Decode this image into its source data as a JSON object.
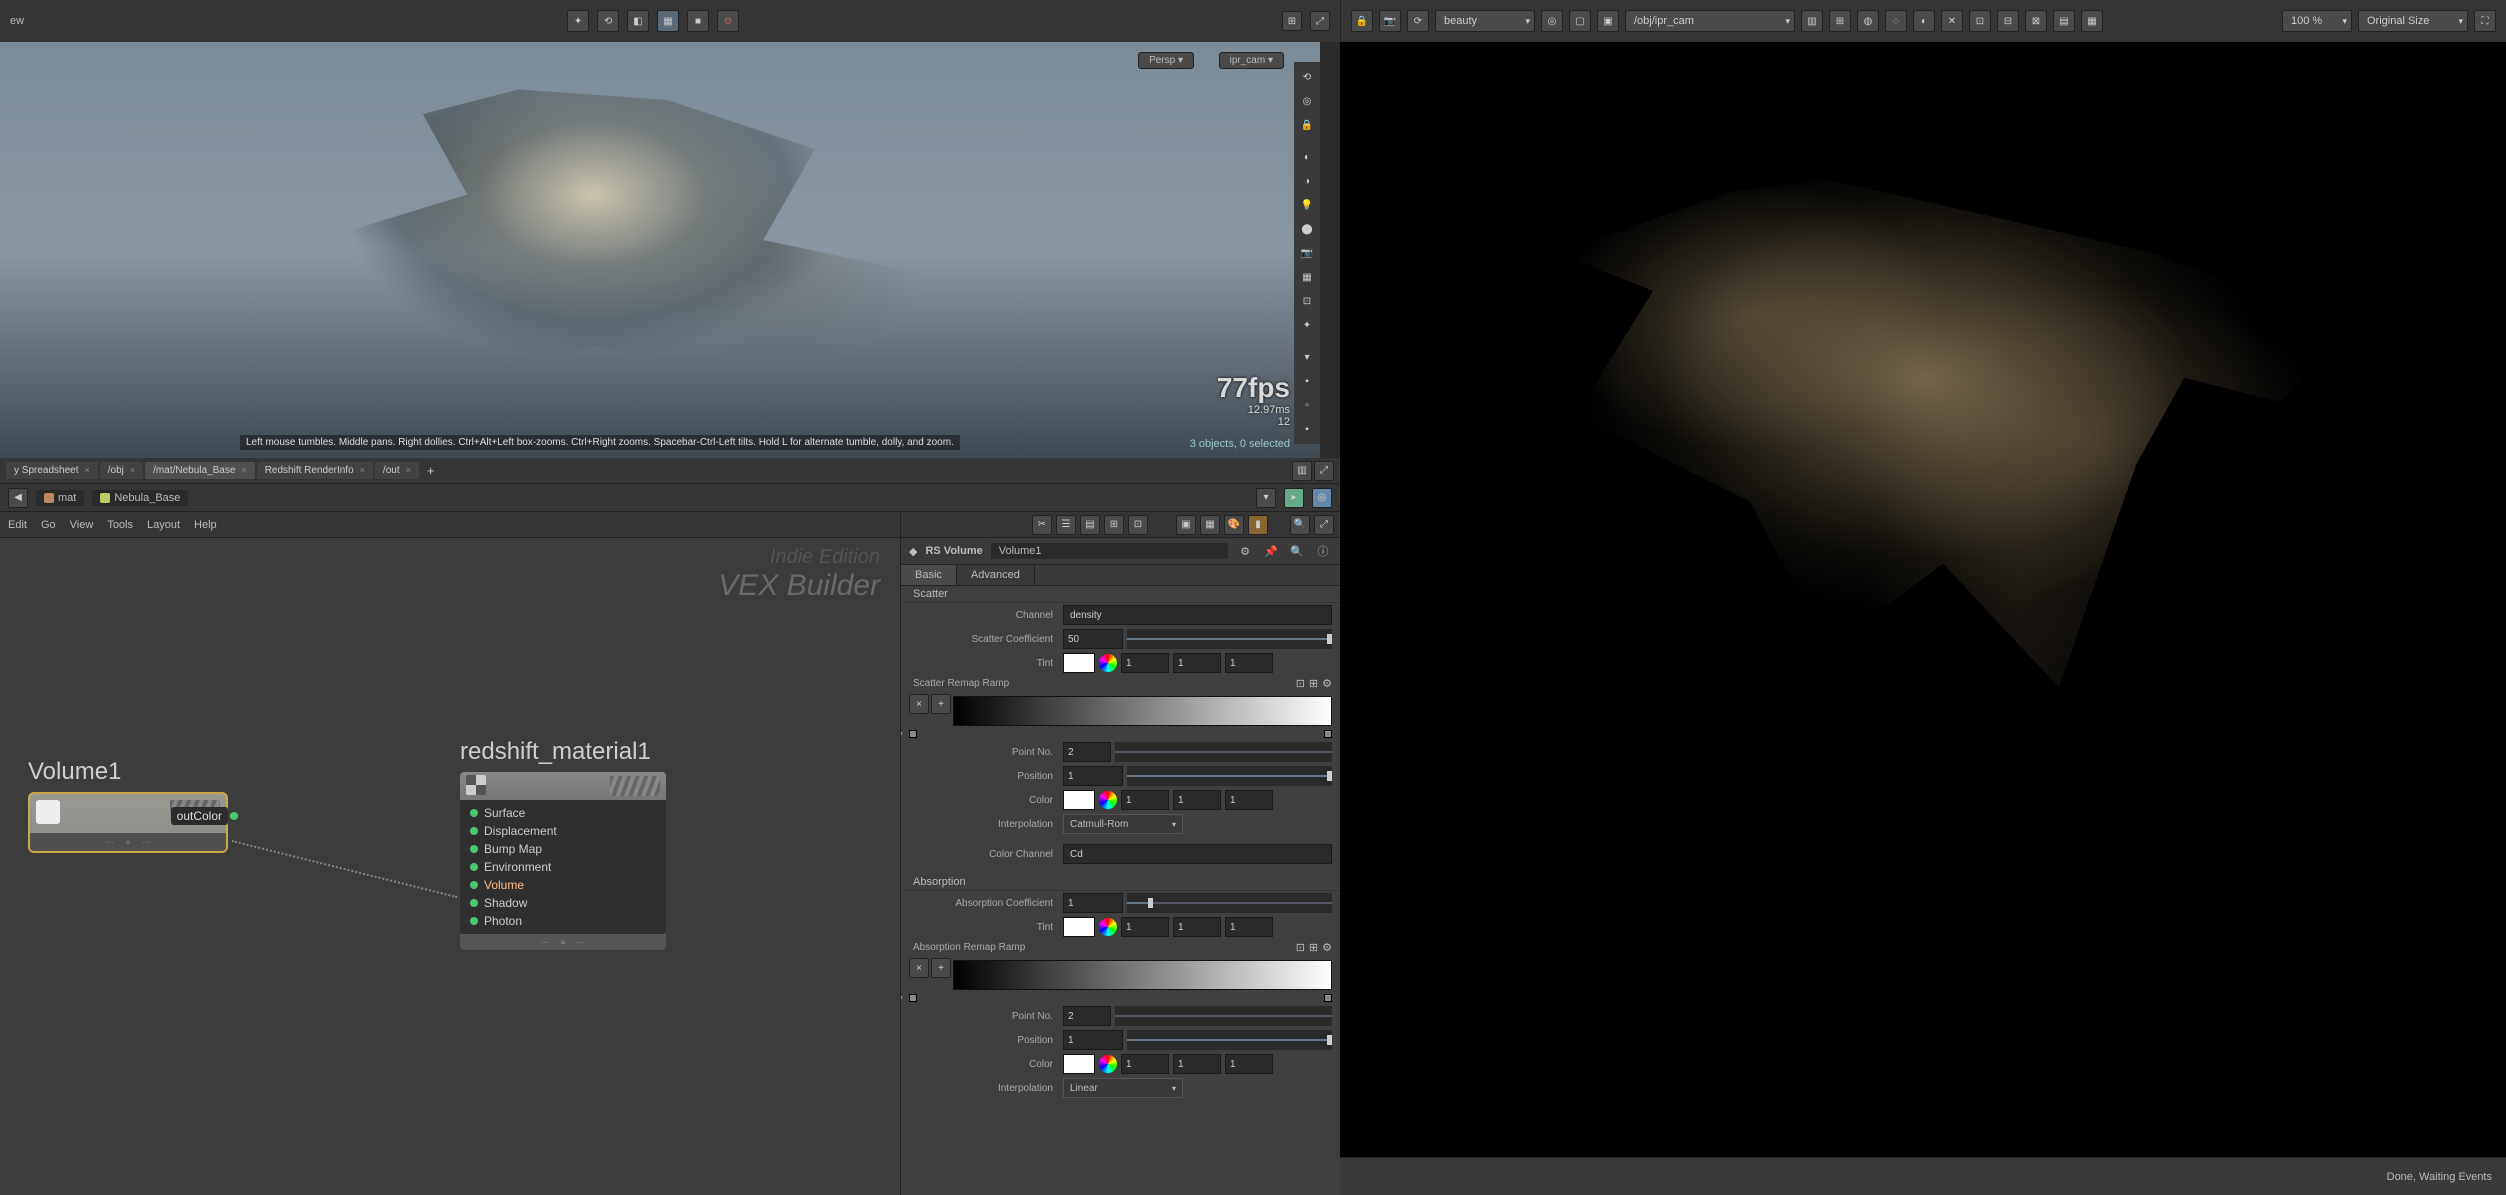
{
  "viewport": {
    "view_label": "ew",
    "persp_pill": "Persp ▾",
    "cam_pill": "ipr_cam ▾",
    "fps": "77fps",
    "ms": "12.97ms",
    "render_idx": "12",
    "stats": "3 objects, 0 selected",
    "hint": "Left mouse tumbles. Middle pans. Right dollies. Ctrl+Alt+Left box-zooms. Ctrl+Right zooms. Spacebar-Ctrl-Left tilts. Hold L for alternate tumble, dolly, and zoom."
  },
  "render_toolbar": {
    "aov": "beauty",
    "path": "/obj/ipr_cam",
    "zoom": "100 %",
    "size": "Original Size"
  },
  "status": "Done, Waiting Events",
  "tabs": [
    {
      "label": "y Spreadsheet"
    },
    {
      "label": "/obj"
    },
    {
      "label": "/mat/Nebula_Base"
    },
    {
      "label": "Redshift RenderInfo"
    },
    {
      "label": "/out"
    }
  ],
  "crumbs": [
    {
      "label": "mat"
    },
    {
      "label": "Nebula_Base"
    }
  ],
  "menus": [
    "Edit",
    "Go",
    "View",
    "Tools",
    "Layout",
    "Help"
  ],
  "watermark": {
    "indie": "Indie Edition",
    "vex": "VEX Builder"
  },
  "nodes": {
    "volume": {
      "title": "Volume1",
      "out": "outColor"
    },
    "mat": {
      "title": "redshift_material1",
      "inputs": [
        "Surface",
        "Displacement",
        "Bump Map",
        "Environment",
        "Volume",
        "Shadow",
        "Photon"
      ]
    }
  },
  "params": {
    "type": "RS Volume",
    "name": "Volume1",
    "tabs": [
      "Basic",
      "Advanced"
    ],
    "scatter": {
      "section": "Scatter",
      "channel_label": "Channel",
      "channel": "density",
      "coef_label": "Scatter Coefficient",
      "coef": "50",
      "tint_label": "Tint",
      "tint": [
        "1",
        "1",
        "1"
      ],
      "ramp_label": "Scatter Remap Ramp",
      "point_label": "Point No.",
      "point": "2",
      "pos_label": "Position",
      "pos": "1",
      "color_label": "Color",
      "color": [
        "1",
        "1",
        "1"
      ],
      "interp_label": "Interpolation",
      "interp": "Catmull-Rom",
      "cch_label": "Color Channel",
      "cch": "Cd"
    },
    "absorb": {
      "section": "Absorption",
      "coef_label": "Absorption Coefficient",
      "coef": "1",
      "tint_label": "Tint",
      "tint": [
        "1",
        "1",
        "1"
      ],
      "ramp_label": "Absorption Remap Ramp",
      "point_label": "Point No.",
      "point": "2",
      "pos_label": "Position",
      "pos": "1",
      "color_label": "Color",
      "color": [
        "1",
        "1",
        "1"
      ],
      "interp_label": "Interpolation",
      "interp": "Linear"
    }
  }
}
